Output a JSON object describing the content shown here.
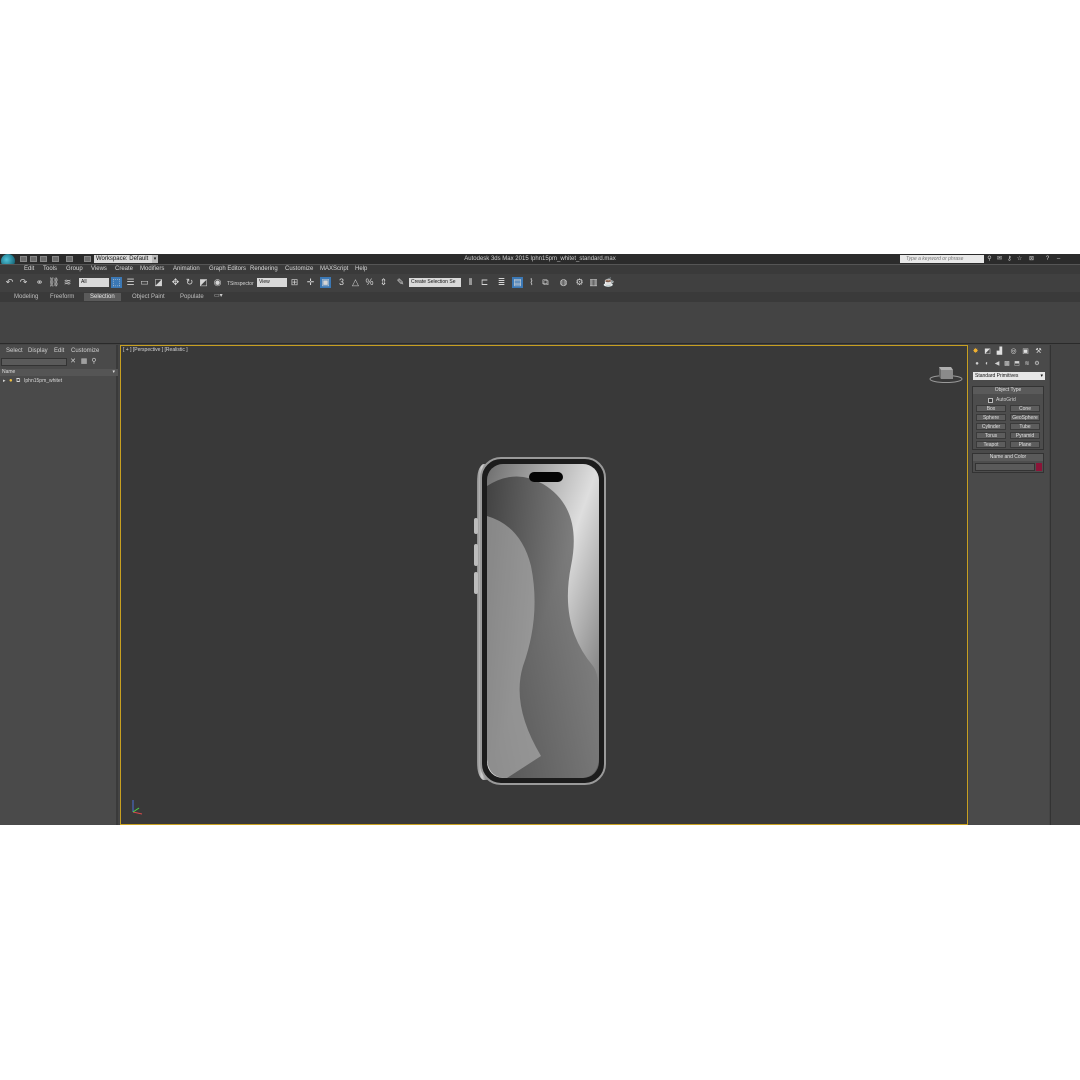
{
  "window": {
    "title": "Autodesk 3ds Max  2015     Iphn15pm_whitet_standard.max",
    "workspace": "Workspace: Default",
    "search_placeholder": "Type a keyword or phrase"
  },
  "menu": [
    "Edit",
    "Tools",
    "Group",
    "Views",
    "Create",
    "Modifiers",
    "Animation",
    "Graph Editors",
    "Rendering",
    "Customize",
    "MAXScript",
    "Help"
  ],
  "toolbar": {
    "filter_value": "All",
    "ref_coord": "View",
    "selection_set": "Create Selection Se",
    "tsinspector": "TSinspector"
  },
  "ribbon": {
    "tabs": [
      "Modeling",
      "Freeform",
      "Selection",
      "Object Paint",
      "Populate"
    ],
    "active_tab": "Selection"
  },
  "scene_explorer": {
    "menus": [
      "Select",
      "Display",
      "Edit",
      "Customize"
    ],
    "column_header": "Name",
    "objects": [
      "Iphn15pm_whitet"
    ]
  },
  "viewport": {
    "label": "[ + ] [Perspective ] [Realistic ]"
  },
  "command_panel": {
    "category": "Standard Primitives",
    "object_type_title": "Object Type",
    "autogrid_label": "AutoGrid",
    "primitives": [
      "Box",
      "Cone",
      "Sphere",
      "GeoSphere",
      "Cylinder",
      "Tube",
      "Torus",
      "Pyramid",
      "Teapot",
      "Plane"
    ],
    "name_color_title": "Name and Color",
    "swatch_color": "#8a1538"
  }
}
